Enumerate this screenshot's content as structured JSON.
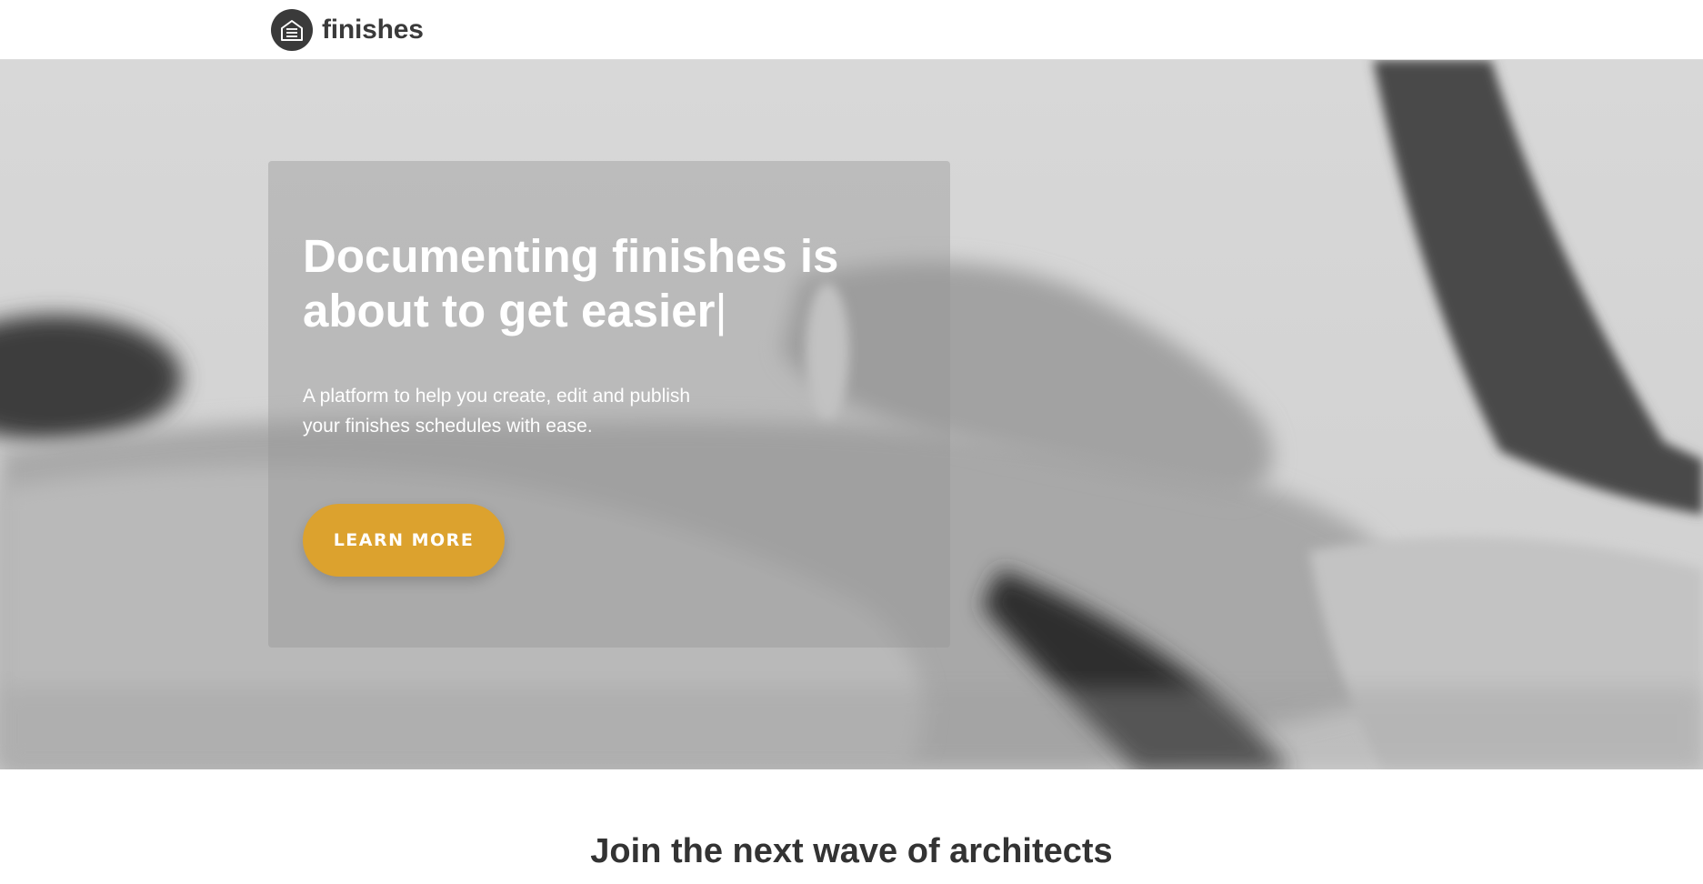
{
  "header": {
    "brand_name": "finishes",
    "logo_icon": "building-icon"
  },
  "hero": {
    "title_line1": "Documenting finishes is",
    "title_line2": "about to get easier",
    "typing_cursor": "|",
    "subtitle_line1": "A platform to help you create, edit and publish",
    "subtitle_line2": "your finishes schedules with ease.",
    "cta_label": "LEARN MORE",
    "background_description_icon": "typing-on-keyboard-photo"
  },
  "section": {
    "title": "Join the next wave of architects"
  },
  "colors": {
    "accent": "#dca22e",
    "text_dark": "#333333",
    "logo_bg": "#3a3a3a"
  }
}
